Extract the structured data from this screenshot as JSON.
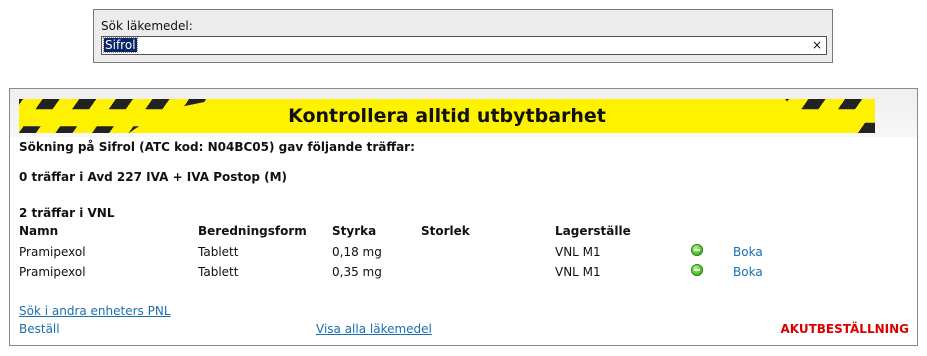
{
  "search": {
    "label": "Sök läkemedel:",
    "value": "Sifrol",
    "clear_icon": "×"
  },
  "banner": {
    "text": "Kontrollera alltid utbytbarhet"
  },
  "results": {
    "summary": "Sökning på Sifrol (ATC kod: N04BC05) gav följande träffar:",
    "unit_hits": "0 träffar i Avd 227 IVA + IVA Postop (M)",
    "vnl_hits": "2 träffar i VNL",
    "columns": [
      "Namn",
      "Beredningsform",
      "Styrka",
      "Storlek",
      "Lagerställe"
    ],
    "rows": [
      {
        "name": "Pramipexol",
        "form": "Tablett",
        "strength": "0,18 mg",
        "size": "",
        "location": "VNL M1",
        "status_icon": "in-stock-icon",
        "action": "Boka"
      },
      {
        "name": "Pramipexol",
        "form": "Tablett",
        "strength": "0,35 mg",
        "size": "",
        "location": "VNL M1",
        "status_icon": "in-stock-icon",
        "action": "Boka"
      }
    ]
  },
  "footer": {
    "other_units_link": "Sök i andra enheters PNL",
    "order_link": "Beställ",
    "show_all_link": "Visa alla läkemedel",
    "urgent_link": "AKUTBESTÄLLNING"
  },
  "colors": {
    "banner_yellow": "#fff200",
    "link_blue": "#1a6fb1",
    "urgent_red": "#dd0000",
    "status_green": "#4fbf2a"
  }
}
